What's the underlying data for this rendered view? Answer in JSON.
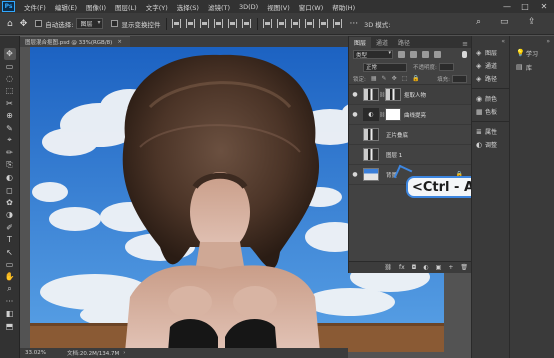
{
  "menubar": {
    "logo": "Ps",
    "items": [
      "文件(F)",
      "编辑(E)",
      "图像(I)",
      "图层(L)",
      "文字(Y)",
      "选择(S)",
      "滤镜(T)",
      "3D(D)",
      "视图(V)",
      "窗口(W)",
      "帮助(H)"
    ],
    "minimize": "—",
    "maximize": "□",
    "close": "✕"
  },
  "options": {
    "home_icon": "⌂",
    "move_icon": "✥",
    "auto_select_label": "自动选择:",
    "auto_select_value": "图层",
    "show_transform_label": "显示变换控件",
    "mode_label": "3D 模式:",
    "more_icon": "···",
    "search_icon": "⌕",
    "workspace_icon": "▭",
    "share_icon": "⇪"
  },
  "document": {
    "tab_title": "图层混合抠图.psd @ 33%(RGB/8)",
    "tab_close": "×",
    "zoom": "33.02%",
    "doc_size": "文档:20.2M/134.7M",
    "status_arrow": "›"
  },
  "tools": [
    "✥",
    "▭",
    "◌",
    "⬚",
    "✂",
    "⊕",
    "✎",
    "⌖",
    "✏",
    "⎘",
    "◐",
    "◻",
    "✿",
    "◑",
    "✐",
    "T",
    "↖",
    "▭",
    "✋",
    "⌕",
    "···",
    "◧",
    "⬒"
  ],
  "layers_panel": {
    "tabs": [
      "图层",
      "通道",
      "路径"
    ],
    "active_tab": "图层",
    "menu_icon": "≡",
    "filter_kind": "类型",
    "blend_mode": "正常",
    "opacity_label": "不透明度:",
    "lock_label": "锁定:",
    "fill_label": "填充:",
    "layers": [
      {
        "name": "抠取人物",
        "type": "portrait",
        "visible": true,
        "locked": false
      },
      {
        "name": "曲线提亮",
        "type": "curve",
        "visible": true,
        "locked": false
      },
      {
        "name": "正片叠底",
        "type": "portrait",
        "visible": false,
        "locked": false
      },
      {
        "name": "图层 1",
        "type": "portrait",
        "visible": false,
        "locked": false
      },
      {
        "name": "背景",
        "type": "sky",
        "visible": true,
        "locked": true
      }
    ],
    "footer_icons": [
      "⛓",
      "fx",
      "◘",
      "◐",
      "▣",
      "+",
      "🗑"
    ]
  },
  "side_panels": {
    "group1": [
      {
        "icon": "◈",
        "label": "图层"
      },
      {
        "icon": "◈",
        "label": "通道"
      },
      {
        "icon": "◈",
        "label": "路径"
      }
    ],
    "group2": [
      {
        "icon": "◉",
        "label": "颜色"
      },
      {
        "icon": "▦",
        "label": "色板"
      }
    ],
    "group3": [
      {
        "icon": "≣",
        "label": "属性"
      },
      {
        "icon": "◐",
        "label": "调整"
      }
    ],
    "expander": "«"
  },
  "learn_panel": {
    "items": [
      {
        "icon": "💡",
        "label": "学习"
      },
      {
        "icon": "▤",
        "label": "库"
      }
    ],
    "expander": "»"
  },
  "callout": {
    "text": "<Ctrl - Alt - a>"
  },
  "colors": {
    "accent": "#31a8ff",
    "callout_border": "#3d86e0",
    "panel_bg": "#424242"
  }
}
